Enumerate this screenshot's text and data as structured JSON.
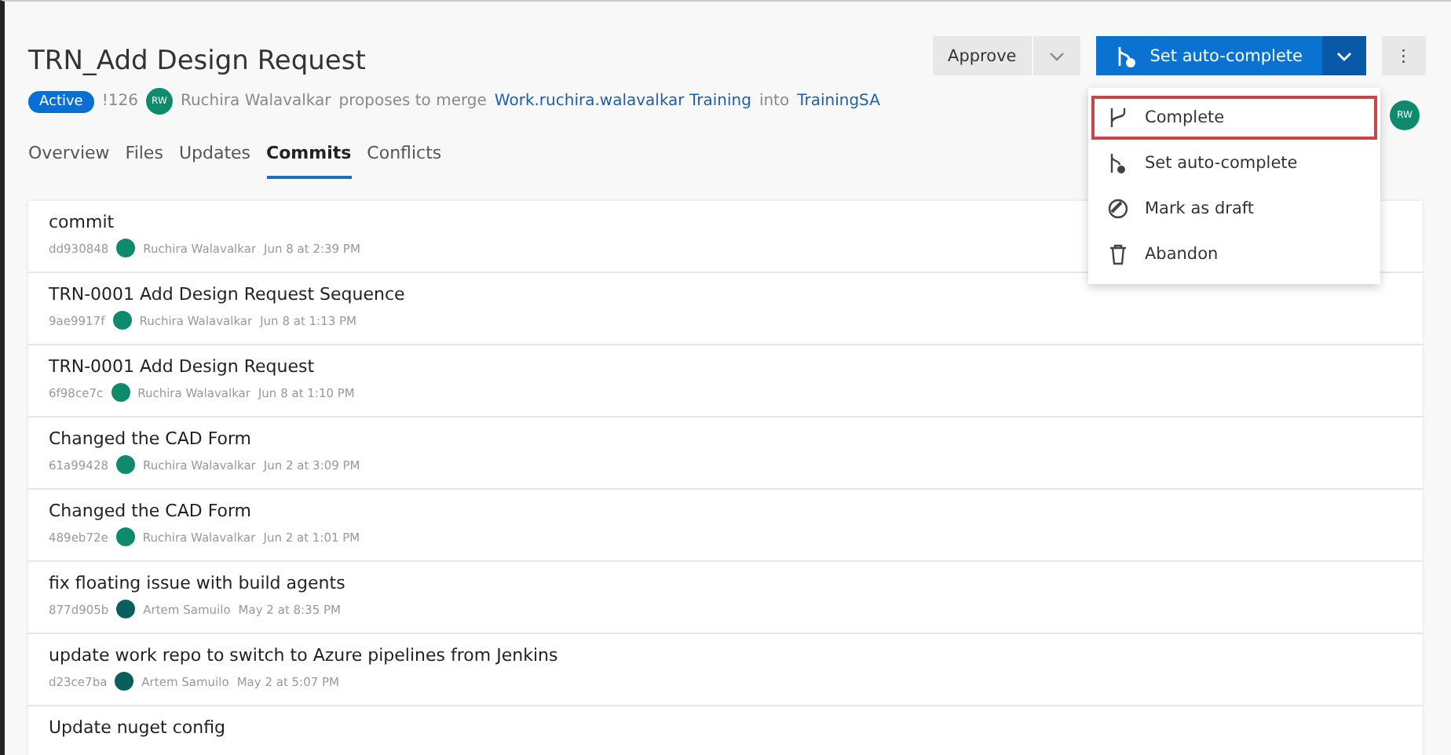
{
  "title": "TRN_Add Design Request",
  "status": {
    "label": "Active"
  },
  "pr_id": "!126",
  "author_avatar": {
    "initials": "RW"
  },
  "proposal": {
    "author": "Ruchira Walavalkar",
    "text": "proposes to merge",
    "source": "Work.ruchira.walavalkar Training",
    "into": "into",
    "target": "TrainingSA"
  },
  "tabs": [
    {
      "label": "Overview",
      "selected": false
    },
    {
      "label": "Files",
      "selected": false
    },
    {
      "label": "Updates",
      "selected": false
    },
    {
      "label": "Commits",
      "selected": true
    },
    {
      "label": "Conflicts",
      "selected": false
    }
  ],
  "actions": {
    "approve": "Approve",
    "primary": "Set auto-complete",
    "more": "⋮"
  },
  "reviewer_avatar": {
    "initials": "RW"
  },
  "menu": [
    {
      "kind": "merge",
      "label": "Complete",
      "selected": true
    },
    {
      "kind": "auto",
      "label": "Set auto-complete",
      "selected": false
    },
    {
      "kind": "draft",
      "label": "Mark as draft",
      "selected": false
    },
    {
      "kind": "trash",
      "label": "Abandon",
      "selected": false
    }
  ],
  "commits": [
    {
      "message": "commit",
      "hash": "dd930848",
      "author": "Ruchira Walavalkar",
      "date": "Jun 8 at 2:39 PM",
      "color": "#0e8a6c"
    },
    {
      "message": "TRN-0001 Add Design Request Sequence",
      "hash": "9ae9917f",
      "author": "Ruchira Walavalkar",
      "date": "Jun 8 at 1:13 PM",
      "color": "#0e8a6c"
    },
    {
      "message": "TRN-0001 Add Design Request",
      "hash": "6f98ce7c",
      "author": "Ruchira Walavalkar",
      "date": "Jun 8 at 1:10 PM",
      "color": "#0e8a6c"
    },
    {
      "message": "Changed the CAD Form",
      "hash": "61a99428",
      "author": "Ruchira Walavalkar",
      "date": "Jun 2 at 3:09 PM",
      "color": "#0e8a6c"
    },
    {
      "message": "Changed the CAD Form",
      "hash": "489eb72e",
      "author": "Ruchira Walavalkar",
      "date": "Jun 2 at 1:01 PM",
      "color": "#0e8a6c"
    },
    {
      "message": "fix floating issue with build agents",
      "hash": "877d905b",
      "author": "Artem Samuilo",
      "date": "May 2 at 8:35 PM",
      "color": "#0b5e5e"
    },
    {
      "message": "update work repo to switch to Azure pipelines from Jenkins",
      "hash": "d23ce7ba",
      "author": "Artem Samuilo",
      "date": "May 2 at 5:07 PM",
      "color": "#0b5e5e"
    },
    {
      "message": "Update nuget config"
    }
  ]
}
